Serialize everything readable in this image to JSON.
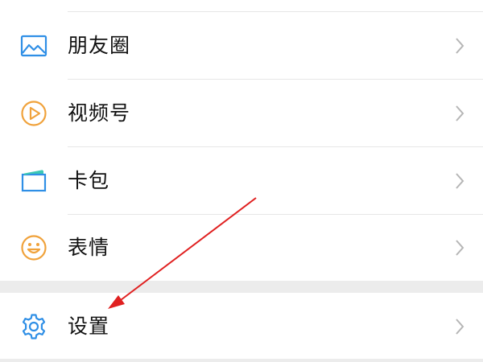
{
  "menu": {
    "items": [
      {
        "label": "朋友圈",
        "icon": "photo-landscape-icon",
        "icon_color": "#2f8fe6"
      },
      {
        "label": "视频号",
        "icon": "video-channel-play-icon",
        "icon_color": "#f0a23b"
      },
      {
        "label": "卡包",
        "icon": "card-wallet-icon",
        "icon_color": "#2f8fe6"
      },
      {
        "label": "表情",
        "icon": "smiley-face-icon",
        "icon_color": "#f0a23b"
      },
      {
        "label": "设置",
        "icon": "gear-icon",
        "icon_color": "#2f8fe6"
      }
    ]
  },
  "colors": {
    "background": "#ffffff",
    "section_gap": "#ececec",
    "divider": "#e6e6e6",
    "chevron": "#b5b5b5",
    "annotation_arrow": "#e02020",
    "text": "#111111"
  }
}
